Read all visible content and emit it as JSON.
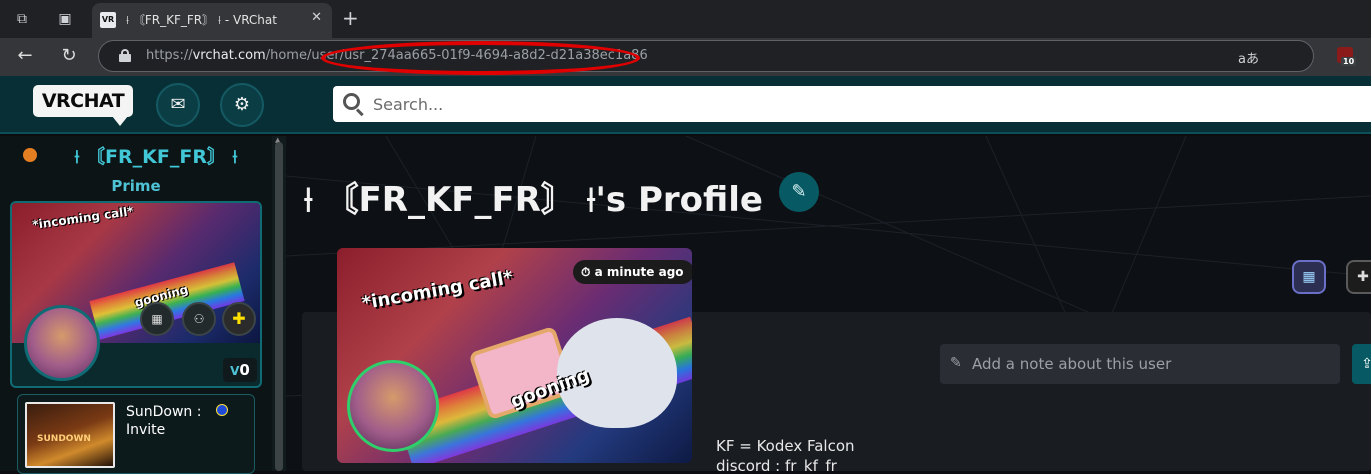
{
  "browser": {
    "tab": {
      "favicon": "VR",
      "title": "⟊ 〘FR_KF_FR〙 ⟊ - VRChat",
      "close_icon": "close-icon"
    },
    "new_tab": "+",
    "url_prefix": "https://",
    "url_host": "vrchat.com",
    "url_path": "/home/user",
    "url_id": "/usr_274aa665-01f9-4694-a8d2-d21a38ec1a86",
    "read_aloud": "aあ",
    "extension_badge": "10",
    "annotation_color": "#e00000"
  },
  "header": {
    "logo": "VRCHAT",
    "search_placeholder": "Search...",
    "accent_color": "#072f35"
  },
  "sidebar": {
    "username": "⟊ 〘FR_KF_FR〙 ⟊",
    "rank": "Prime",
    "status_color": "#e67e22",
    "current_card": {
      "caption_top": "*incoming call*",
      "caption_bottom": "gooning",
      "credits_glyph": "V",
      "credits": "0"
    },
    "friend": {
      "thumb_label": "SUNDOWN",
      "name": "SunDown : Invite"
    }
  },
  "profile": {
    "title_name": "⟊ 〘FR_KF_FR〙 ⟊",
    "title_suffix": "'s Profile",
    "image_caption_top": "*incoming call*",
    "image_caption_bottom": "gooning",
    "last_seen": "a minute ago",
    "note_placeholder": "Add a note about this user",
    "bio_line1": "KF  =  Kodex Falcon",
    "bio_line2": "discord : fr_kf_fr"
  }
}
